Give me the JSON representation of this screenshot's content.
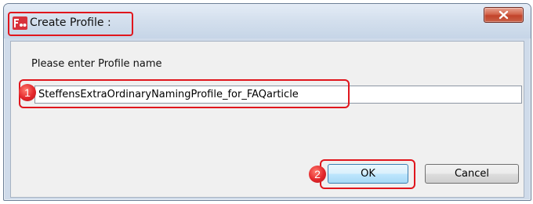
{
  "window": {
    "title": "Create Profile :",
    "close_label": "x"
  },
  "form": {
    "prompt_label": "Please enter Profile name",
    "profile_name_value": "SteffensExtraOrdinaryNamingProfile_for_FAQarticle"
  },
  "buttons": {
    "ok_label": "OK",
    "cancel_label": "Cancel"
  },
  "annotations": {
    "step1": "1",
    "step2": "2",
    "highlight_color": "#e0161d"
  },
  "icons": {
    "app_icon": "app-logo-icon",
    "close_icon": "close-icon"
  }
}
